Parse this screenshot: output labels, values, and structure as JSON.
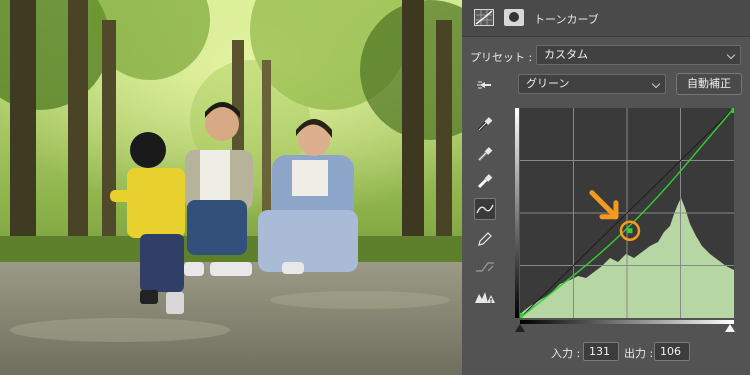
{
  "panel": {
    "title": "トーンカーブ",
    "icons": [
      "curves-adjustment-icon",
      "layer-mask-icon"
    ]
  },
  "preset": {
    "label": "プリセット :",
    "value": "カスタム"
  },
  "channel": {
    "value": "グリーン",
    "auto_button": "自動補正"
  },
  "tools": [
    "target-adjust-icon",
    "black-point-eyedropper-icon",
    "gray-point-eyedropper-icon",
    "white-point-eyedropper-icon",
    "curve-edit-icon",
    "pencil-draw-icon",
    "smooth-curve-icon",
    "clipping-warning-icon"
  ],
  "active_tool": "curve-edit-icon",
  "curve": {
    "channel_color": "#2fd12f",
    "points": [
      [
        0,
        0
      ],
      [
        131,
        106
      ],
      [
        255,
        255
      ]
    ],
    "selected_point": [
      131,
      106
    ],
    "marker_color": "#f59a1e"
  },
  "io": {
    "input_label": "入力 :",
    "input_value": "131",
    "output_label": "出力 :",
    "output_value": "106"
  },
  "colors": {
    "panel_bg": "#535353",
    "histogram": "#b6d6a4",
    "graph_bg": "#3a3a3a",
    "accent_orange": "#f59a1e"
  }
}
